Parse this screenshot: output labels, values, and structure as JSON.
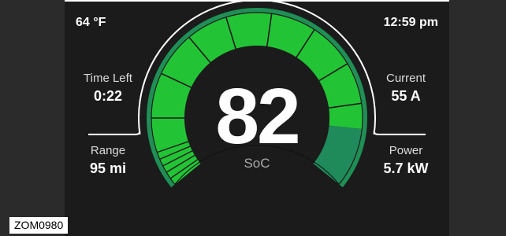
{
  "status_bar": {
    "temperature": "64 °F",
    "time": "12:59 pm"
  },
  "left_panel": {
    "time_left": {
      "label": "Time Left",
      "value": "0:22"
    },
    "range": {
      "label": "Range",
      "value": "95 mi"
    }
  },
  "right_panel": {
    "current": {
      "label": "Current",
      "value": "55 A"
    },
    "power": {
      "label": "Power",
      "value": "5.7 kW"
    }
  },
  "gauge": {
    "soc_value": "82",
    "soc_label": "SoC",
    "charge_color": "#22c436",
    "power_segment_color": "#1f8a5a",
    "outer_band_color": "#1f8f55"
  },
  "figure_id": "ZOM0980"
}
